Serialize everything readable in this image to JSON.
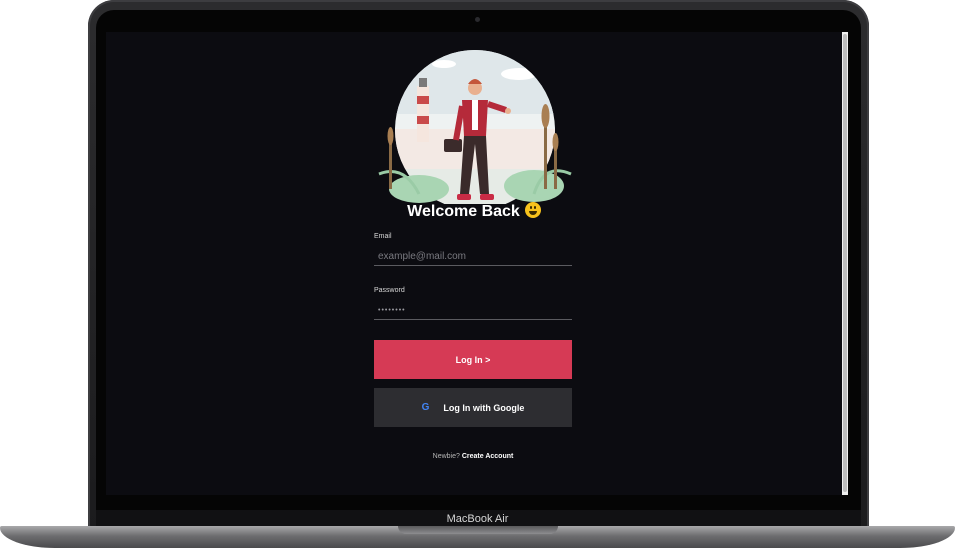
{
  "device": {
    "label": "MacBook Air"
  },
  "login": {
    "title": "Welcome Back",
    "email_label": "Email",
    "email_placeholder": "example@mail.com",
    "password_label": "Password",
    "password_masked": "••••••••",
    "login_button": "Log In >",
    "google_button": "Log In with Google",
    "google_icon_glyph": "G",
    "signup_prompt": "Newbie?",
    "signup_link": "Create Account"
  },
  "colors": {
    "screen_bg": "#0c0c11",
    "accent": "#d63a55",
    "secondary_button": "#2d2d31"
  }
}
